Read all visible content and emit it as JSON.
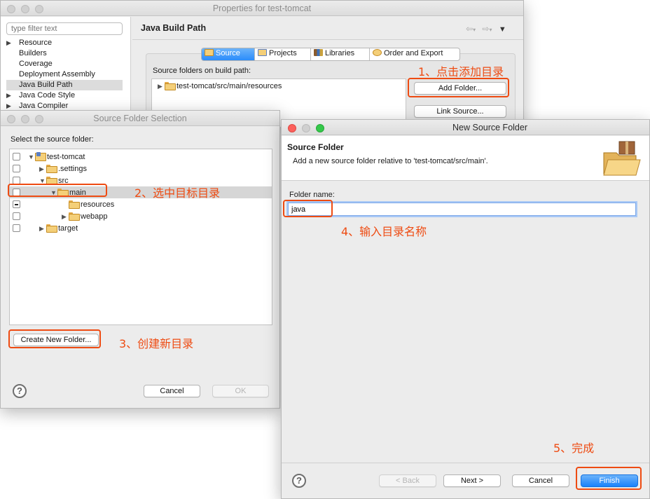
{
  "properties_window": {
    "title": "Properties for test-tomcat",
    "filter_placeholder": "type filter text",
    "nav_items": [
      {
        "label": "Resource",
        "expandable": true
      },
      {
        "label": "Builders",
        "expandable": false
      },
      {
        "label": "Coverage",
        "expandable": false
      },
      {
        "label": "Deployment Assembly",
        "expandable": false
      },
      {
        "label": "Java Build Path",
        "expandable": false,
        "selected": true
      },
      {
        "label": "Java Code Style",
        "expandable": true
      },
      {
        "label": "Java Compiler",
        "expandable": true
      }
    ],
    "page_title": "Java Build Path",
    "tabs": [
      "Source",
      "Projects",
      "Libraries",
      "Order and Export"
    ],
    "source_folders_label": "Source folders on build path:",
    "source_folder_item": "test-tomcat/src/main/resources",
    "add_folder_button": "Add Folder...",
    "link_source_button": "Link Source..."
  },
  "source_folder_selection": {
    "title": "Source Folder Selection",
    "prompt": "Select the source folder:",
    "tree": [
      {
        "label": "test-tomcat",
        "type": "project",
        "expanded": true
      },
      {
        "label": ".settings",
        "type": "folder",
        "expanded": false
      },
      {
        "label": "src",
        "type": "folder",
        "expanded": true
      },
      {
        "label": "main",
        "type": "folder",
        "expanded": true,
        "selected": true
      },
      {
        "label": "resources",
        "type": "folder",
        "checkbox": "mixed"
      },
      {
        "label": "webapp",
        "type": "folder",
        "expanded": false
      },
      {
        "label": "target",
        "type": "folder",
        "expanded": false
      }
    ],
    "create_new_folder_button": "Create New Folder...",
    "cancel_button": "Cancel",
    "ok_button": "OK"
  },
  "new_source_folder": {
    "title": "New Source Folder",
    "header_title": "Source Folder",
    "header_description": "Add a new source folder relative to 'test-tomcat/src/main'.",
    "folder_name_label": "Folder name:",
    "folder_name_value": "java",
    "back_button": "< Back",
    "next_button": "Next >",
    "cancel_button": "Cancel",
    "finish_button": "Finish"
  },
  "annotations": {
    "step1": "1、点击添加目录",
    "step2": "2、选中目标目录",
    "step3": "3、创建新目录",
    "step4": "4、输入目录名称",
    "step5": "5、完成"
  },
  "colors": {
    "annotation_red": "#ee4b12",
    "selection_blue": "#2a8cfb"
  }
}
